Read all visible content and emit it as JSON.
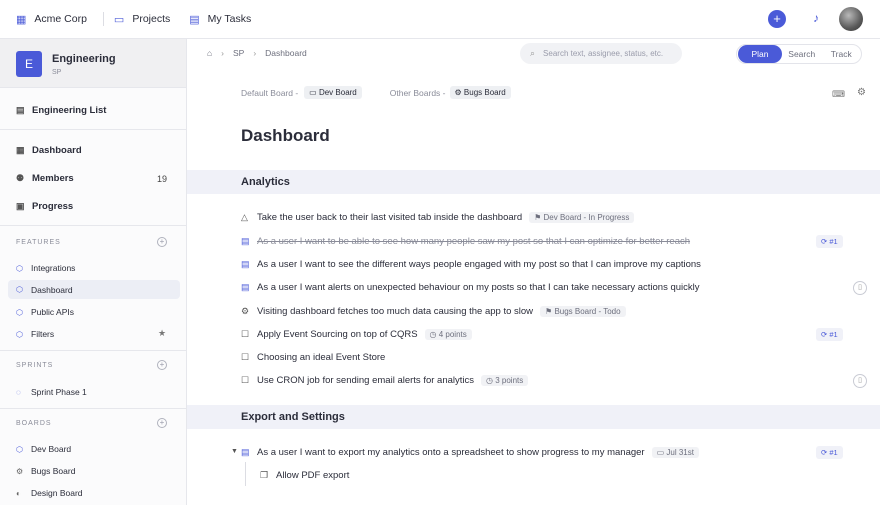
{
  "topbar": {
    "org": "Acme Corp",
    "projects_label": "Projects",
    "tasks_label": "My Tasks",
    "add_label": "+",
    "icons": [
      "building-icon",
      "briefcase-icon",
      "clipboard-icon",
      "plus-icon",
      "bell-icon"
    ]
  },
  "sidebar": {
    "project_initial": "E",
    "project_name": "Engineering",
    "project_key": "SP",
    "list_label": "Engineering List",
    "main": [
      {
        "label": "Dashboard",
        "icon": "dashboard-icon"
      },
      {
        "label": "Members",
        "count": "19",
        "icon": "members-icon"
      },
      {
        "label": "Progress",
        "icon": "progress-icon"
      }
    ],
    "features_title": "FEATURES",
    "features": [
      "Integrations",
      "Dashboard",
      "Public APIs",
      "Filters"
    ],
    "sprints_title": "SPRINTS",
    "sprints": [
      "Sprint Phase 1"
    ],
    "boards_title": "BOARDS",
    "boards": [
      "Dev Board",
      "Bugs Board",
      "Design Board"
    ]
  },
  "breadcrumb": {
    "project": "SP",
    "page": "Dashboard"
  },
  "search": {
    "placeholder": "Search text, assignee, status, etc."
  },
  "modes": [
    "Plan",
    "Search",
    "Track"
  ],
  "active_mode": "Plan",
  "boards_bar": {
    "default_label": "Default Board -",
    "default_board": "Dev Board",
    "other_label": "Other Boards -",
    "other_board": "Bugs Board"
  },
  "page_title": "Dashboard",
  "sections": [
    {
      "title": "Analytics",
      "items": [
        {
          "text": "Take the user back to their last visited tab inside the dashboard",
          "tag": "Dev Board - In Progress",
          "icon": "warning-icon"
        },
        {
          "text": "As a user I want to be able to see how many people saw my post so that I can optimize for better reach",
          "struck": true,
          "chip": "#1",
          "icon": "story-icon"
        },
        {
          "text": "As a user I want to see the different ways people engaged with my post so that I can improve my captions",
          "icon": "story-icon"
        },
        {
          "text": "As a user I want alerts on unexpected behaviour on my posts so that I can take necessary actions quickly",
          "icon": "story-icon",
          "doc": true
        },
        {
          "text": "Visiting dashboard fetches too much data causing the app to slow",
          "tag": "Bugs Board - Todo",
          "icon": "bug-icon"
        },
        {
          "text": "Apply Event Sourcing on top of CQRS",
          "tag": "4 points",
          "chip": "#1",
          "icon": "task-icon"
        },
        {
          "text": "Choosing an ideal Event Store",
          "icon": "task-icon"
        },
        {
          "text": "Use CRON job for sending email alerts for analytics",
          "tag": "3 points",
          "icon": "task-icon",
          "doc": true
        }
      ]
    },
    {
      "title": "Export and Settings",
      "items": [
        {
          "text": "As a user I want to export my analytics onto a spreadsheet to show progress to my manager",
          "tag": "Jul 31st",
          "chip": "#1",
          "icon": "story-icon"
        },
        {
          "text": "Allow PDF export",
          "icon": "subtask-icon"
        }
      ]
    }
  ]
}
